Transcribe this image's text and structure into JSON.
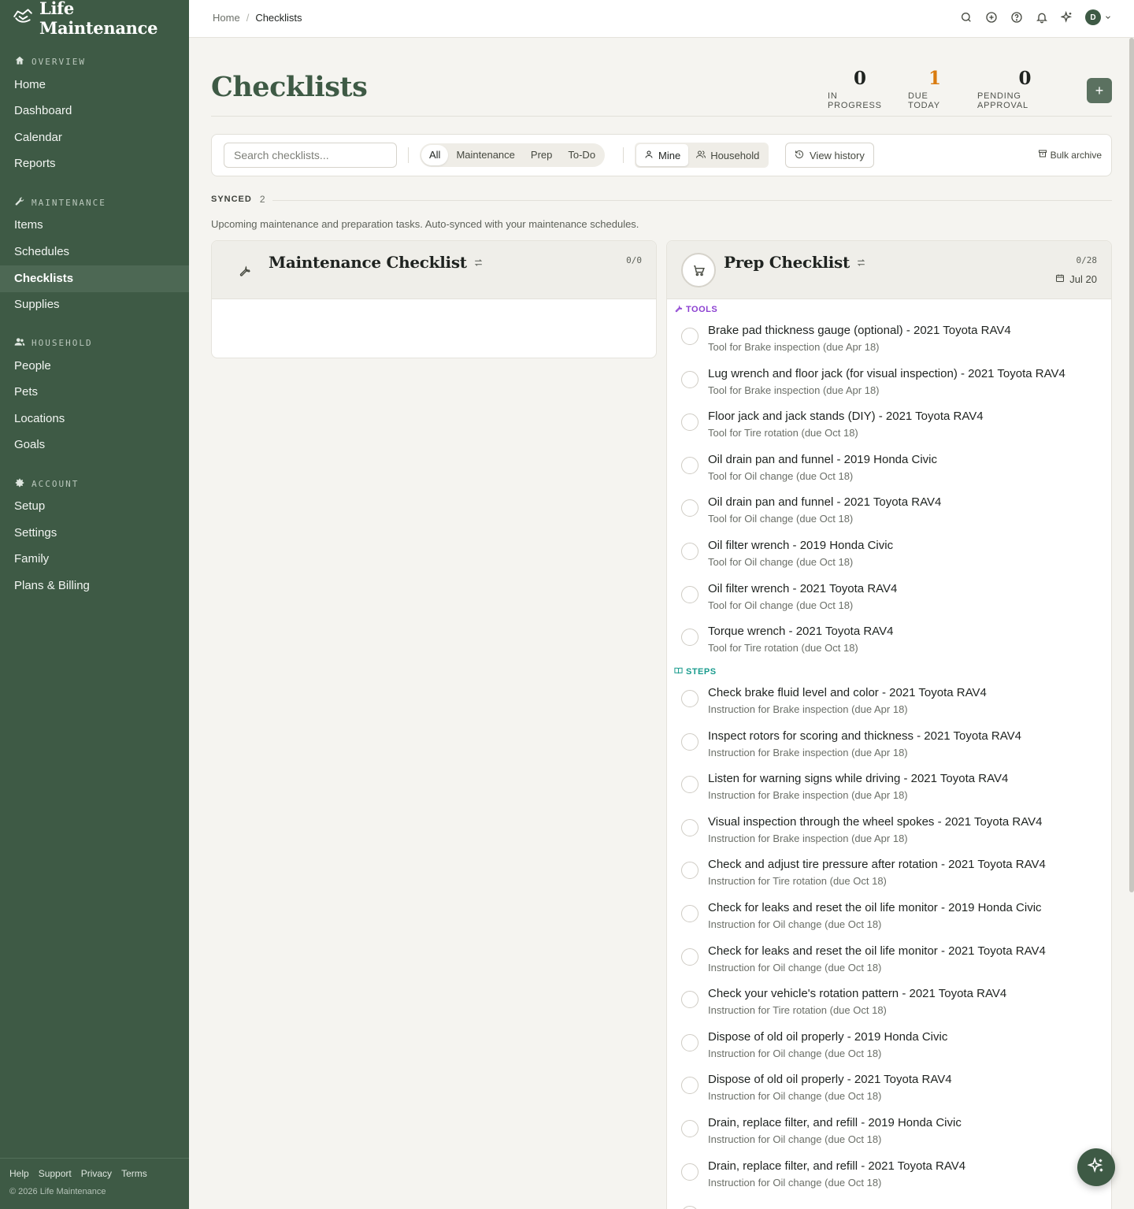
{
  "app": {
    "name": "Life Maintenance"
  },
  "sidebar": {
    "sections": [
      {
        "heading": "OVERVIEW",
        "icon": "home-icon",
        "items": [
          "Home",
          "Dashboard",
          "Calendar",
          "Reports"
        ]
      },
      {
        "heading": "MAINTENANCE",
        "icon": "wrench-icon",
        "items": [
          "Items",
          "Schedules",
          "Checklists",
          "Supplies"
        ]
      },
      {
        "heading": "HOUSEHOLD",
        "icon": "users-icon",
        "items": [
          "People",
          "Pets",
          "Locations",
          "Goals"
        ]
      },
      {
        "heading": "ACCOUNT",
        "icon": "gear-icon",
        "items": [
          "Setup",
          "Settings",
          "Family",
          "Plans & Billing"
        ]
      }
    ],
    "active": "Checklists",
    "footer_links": [
      "Help",
      "Support",
      "Privacy",
      "Terms"
    ],
    "copyright": "© 2026 Life Maintenance"
  },
  "breadcrumb": {
    "home": "Home",
    "sep": "/",
    "current": "Checklists"
  },
  "topbar": {
    "avatar_initial": "D",
    "icons": [
      "search-icon",
      "add-circle-icon",
      "help-icon",
      "bell-icon",
      "sparkles-icon",
      "chevron-down-icon"
    ]
  },
  "page": {
    "title": "Checklists"
  },
  "stats": [
    {
      "value": "0",
      "label": "IN PROGRESS"
    },
    {
      "value": "1",
      "label": "DUE TODAY",
      "color": "#d97b0f"
    },
    {
      "value": "0",
      "label": "PENDING APPROVAL"
    }
  ],
  "add_button": "+",
  "toolbar": {
    "search_placeholder": "Search checklists...",
    "filters": [
      "All",
      "Maintenance",
      "Prep",
      "To-Do"
    ],
    "active_filter": "All",
    "scope": [
      "Mine",
      "Household"
    ],
    "active_scope": "Mine",
    "history_label": "View history",
    "bulk_label": "Bulk archive"
  },
  "synced": {
    "label": "SYNCED",
    "count": "2",
    "description": "Upcoming maintenance and preparation tasks. Auto-synced with your maintenance schedules."
  },
  "maintenance_card": {
    "title": "Maintenance Checklist",
    "count": "0/0"
  },
  "prep_card": {
    "title": "Prep Checklist",
    "count": "0/28",
    "date": "Jul 20",
    "sections": [
      {
        "label": "TOOLS",
        "color": "#8b3fd1",
        "tasks": [
          {
            "title": "Brake pad thickness gauge (optional) - 2021 Toyota RAV4",
            "sub": "Tool for Brake inspection (due Apr 18)"
          },
          {
            "title": "Lug wrench and floor jack (for visual inspection) - 2021 Toyota RAV4",
            "sub": "Tool for Brake inspection (due Apr 18)"
          },
          {
            "title": "Floor jack and jack stands (DIY) - 2021 Toyota RAV4",
            "sub": "Tool for Tire rotation (due Oct 18)"
          },
          {
            "title": "Oil drain pan and funnel - 2019 Honda Civic",
            "sub": "Tool for Oil change (due Oct 18)"
          },
          {
            "title": "Oil drain pan and funnel - 2021 Toyota RAV4",
            "sub": "Tool for Oil change (due Oct 18)"
          },
          {
            "title": "Oil filter wrench - 2019 Honda Civic",
            "sub": "Tool for Oil change (due Oct 18)"
          },
          {
            "title": "Oil filter wrench - 2021 Toyota RAV4",
            "sub": "Tool for Oil change (due Oct 18)"
          },
          {
            "title": "Torque wrench - 2021 Toyota RAV4",
            "sub": "Tool for Tire rotation (due Oct 18)"
          }
        ]
      },
      {
        "label": "STEPS",
        "color": "#1a9c8e",
        "tasks": [
          {
            "title": "Check brake fluid level and color - 2021 Toyota RAV4",
            "sub": "Instruction for Brake inspection (due Apr 18)"
          },
          {
            "title": "Inspect rotors for scoring and thickness - 2021 Toyota RAV4",
            "sub": "Instruction for Brake inspection (due Apr 18)"
          },
          {
            "title": "Listen for warning signs while driving - 2021 Toyota RAV4",
            "sub": "Instruction for Brake inspection (due Apr 18)"
          },
          {
            "title": "Visual inspection through the wheel spokes - 2021 Toyota RAV4",
            "sub": "Instruction for Brake inspection (due Apr 18)"
          },
          {
            "title": "Check and adjust tire pressure after rotation - 2021 Toyota RAV4",
            "sub": "Instruction for Tire rotation (due Oct 18)"
          },
          {
            "title": "Check for leaks and reset the oil life monitor - 2019 Honda Civic",
            "sub": "Instruction for Oil change (due Oct 18)"
          },
          {
            "title": "Check for leaks and reset the oil life monitor - 2021 Toyota RAV4",
            "sub": "Instruction for Oil change (due Oct 18)"
          },
          {
            "title": "Check your vehicle's rotation pattern - 2021 Toyota RAV4",
            "sub": "Instruction for Tire rotation (due Oct 18)"
          },
          {
            "title": "Dispose of old oil properly - 2019 Honda Civic",
            "sub": "Instruction for Oil change (due Oct 18)"
          },
          {
            "title": "Dispose of old oil properly - 2021 Toyota RAV4",
            "sub": "Instruction for Oil change (due Oct 18)"
          },
          {
            "title": "Drain, replace filter, and refill - 2019 Honda Civic",
            "sub": "Instruction for Oil change (due Oct 18)"
          },
          {
            "title": "Drain, replace filter, and refill - 2021 Toyota RAV4",
            "sub": "Instruction for Oil change (due Oct 18)"
          }
        ]
      }
    ]
  },
  "colors": {
    "sidebar": "#3e5a45",
    "accent": "#3e5a45",
    "due_today": "#d97b0f",
    "tools": "#8b3fd1",
    "steps": "#1a9c8e"
  }
}
